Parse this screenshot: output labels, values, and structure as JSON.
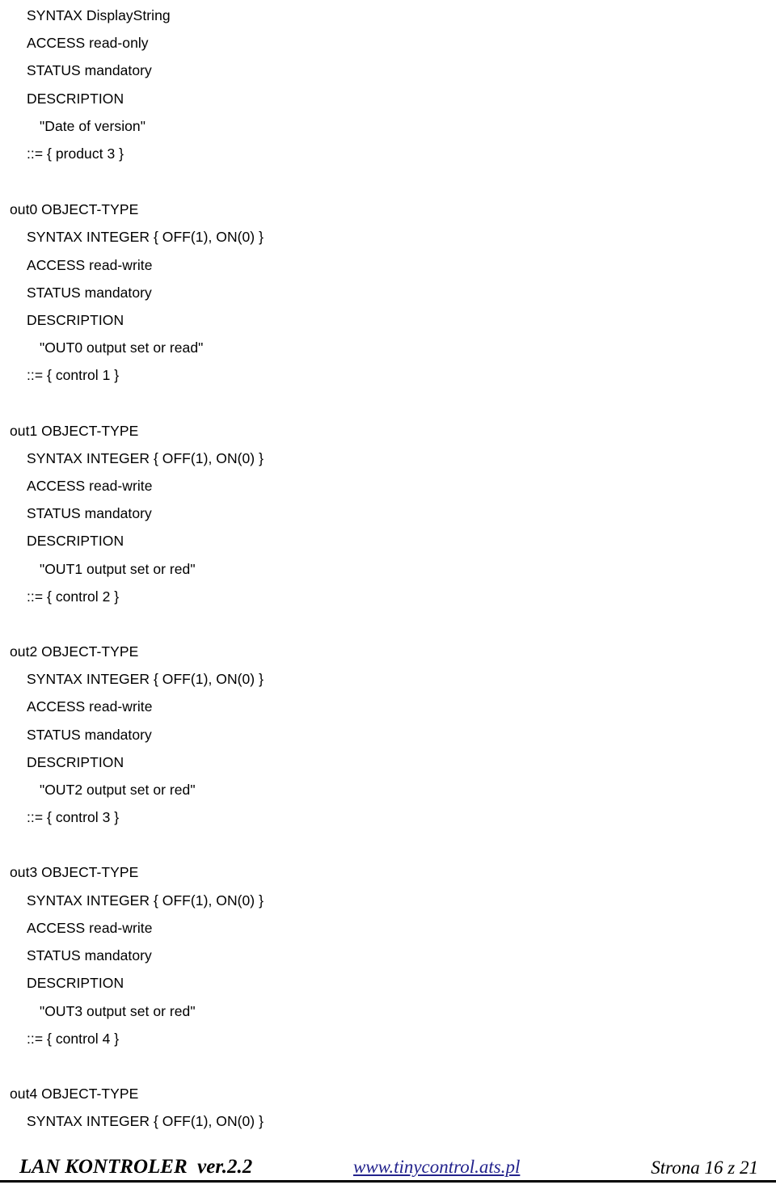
{
  "document": {
    "content_type": "mib-definition-listing",
    "partial_object": {
      "lines": [
        {
          "indent": 1,
          "text": "SYNTAX DisplayString"
        },
        {
          "indent": 1,
          "text": "ACCESS read-only"
        },
        {
          "indent": 1,
          "text": "STATUS mandatory"
        },
        {
          "indent": 1,
          "text": "DESCRIPTION"
        },
        {
          "indent": 2,
          "text": "\"Date of version\""
        },
        {
          "indent": 1,
          "text": "::= { product 3 }"
        }
      ]
    },
    "objects": [
      {
        "name": "out0",
        "header": "out0 OBJECT-TYPE",
        "lines": [
          {
            "indent": 1,
            "text": "SYNTAX INTEGER { OFF(1), ON(0) }"
          },
          {
            "indent": 1,
            "text": "ACCESS read-write"
          },
          {
            "indent": 1,
            "text": "STATUS mandatory"
          },
          {
            "indent": 1,
            "text": "DESCRIPTION"
          },
          {
            "indent": 2,
            "text": "\"OUT0 output set or read\""
          },
          {
            "indent": 1,
            "text": "::= { control 1 }"
          }
        ]
      },
      {
        "name": "out1",
        "header": "out1 OBJECT-TYPE",
        "lines": [
          {
            "indent": 1,
            "text": "SYNTAX INTEGER { OFF(1), ON(0) }"
          },
          {
            "indent": 1,
            "text": "ACCESS read-write"
          },
          {
            "indent": 1,
            "text": "STATUS mandatory"
          },
          {
            "indent": 1,
            "text": "DESCRIPTION"
          },
          {
            "indent": 2,
            "text": "\"OUT1 output set or red\""
          },
          {
            "indent": 1,
            "text": "::= { control 2 }"
          }
        ]
      },
      {
        "name": "out2",
        "header": "out2 OBJECT-TYPE",
        "lines": [
          {
            "indent": 1,
            "text": "SYNTAX INTEGER { OFF(1), ON(0) }"
          },
          {
            "indent": 1,
            "text": "ACCESS read-write"
          },
          {
            "indent": 1,
            "text": "STATUS mandatory"
          },
          {
            "indent": 1,
            "text": "DESCRIPTION"
          },
          {
            "indent": 2,
            "text": "\"OUT2 output set or red\""
          },
          {
            "indent": 1,
            "text": "::= { control 3 }"
          }
        ]
      },
      {
        "name": "out3",
        "header": "out3 OBJECT-TYPE",
        "lines": [
          {
            "indent": 1,
            "text": "SYNTAX INTEGER { OFF(1), ON(0) }"
          },
          {
            "indent": 1,
            "text": "ACCESS read-write"
          },
          {
            "indent": 1,
            "text": "STATUS mandatory"
          },
          {
            "indent": 1,
            "text": "DESCRIPTION"
          },
          {
            "indent": 2,
            "text": "\"OUT3 output set or red\""
          },
          {
            "indent": 1,
            "text": "::= { control 4 }"
          }
        ]
      },
      {
        "name": "out4",
        "header": "out4 OBJECT-TYPE",
        "lines": [
          {
            "indent": 1,
            "text": "SYNTAX INTEGER { OFF(1), ON(0) }"
          }
        ]
      }
    ]
  },
  "footer": {
    "product": "LAN KONTROLER  ver.2.2",
    "url": "www.tinycontrol.ats.pl",
    "page": "Strona 16 z 21",
    "link_color": "#22228c"
  }
}
